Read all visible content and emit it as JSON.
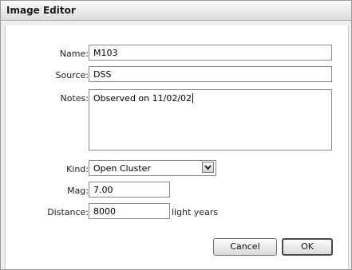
{
  "window": {
    "title": "Image Editor"
  },
  "form": {
    "name": {
      "label": "Name:",
      "value": "M103"
    },
    "source": {
      "label": "Source:",
      "value": "DSS"
    },
    "notes": {
      "label": "Notes:",
      "value": "Observed on 11/02/02"
    },
    "kind": {
      "label": "Kind:",
      "value": "Open Cluster",
      "icon": "chevron-down-icon"
    },
    "mag": {
      "label": "Mag:",
      "value": "7.00"
    },
    "distance": {
      "label": "Distance:",
      "value": "8000",
      "unit": "light years"
    }
  },
  "buttons": {
    "cancel": "Cancel",
    "ok": "OK"
  }
}
